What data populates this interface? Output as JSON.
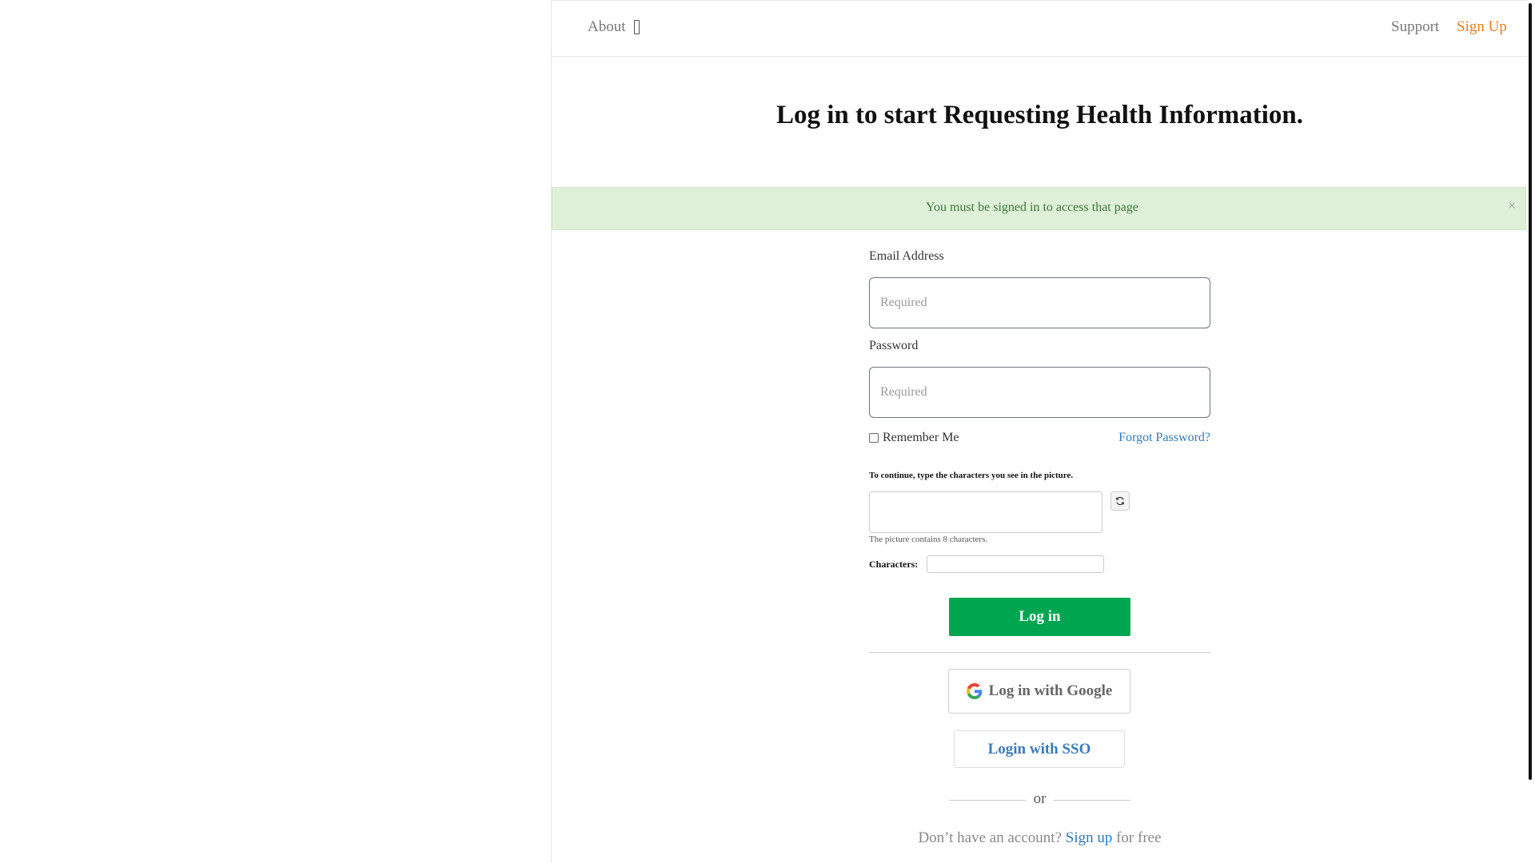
{
  "nav": {
    "about": "About",
    "support": "Support",
    "signup": "Sign Up"
  },
  "title": "Log in to start Requesting Health Information.",
  "alert": {
    "message": "You must be signed in to access that page",
    "close": "×"
  },
  "form": {
    "email_label": "Email Address",
    "email_placeholder": "Required",
    "password_label": "Password",
    "password_placeholder": "Required",
    "remember_label": "Remember Me",
    "forgot_label": "Forgot Password?",
    "captcha_instruction": "To continue, type the characters you see in the picture.",
    "captcha_hint": "The picture contains 8 characters.",
    "characters_label": "Characters:",
    "login_button": "Log in",
    "google_button": "Log in with Google",
    "sso_button": "Login with SSO",
    "or": "or",
    "no_account_prefix": "Don’t have an account?",
    "signup_link": "Sign up",
    "no_account_suffix": "for free"
  },
  "colors": {
    "login_green": "#00a550",
    "signup_orange": "#e67e22",
    "link_blue": "#337ab7",
    "alert_bg": "#dff0d8"
  },
  "icons": {
    "about_dropdown": "chevron-down-icon",
    "refresh": "refresh-icon",
    "google": "google-icon",
    "alert_close": "close-icon"
  }
}
